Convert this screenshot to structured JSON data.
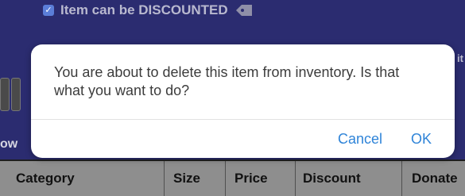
{
  "background": {
    "discount_option": {
      "checked": true,
      "check_glyph": "✓",
      "label": "Item can be DISCOUNTED"
    },
    "right_edge_text": "it",
    "left_edge_text": "ow"
  },
  "table": {
    "headers": [
      "Category",
      "Size",
      "Price",
      "Discount",
      "Donate"
    ]
  },
  "dialog": {
    "message": "You are about to delete this item from inventory. Is that what you want to do?",
    "cancel_label": "Cancel",
    "ok_label": "OK"
  },
  "colors": {
    "app_background": "#2b2c70",
    "dialog_button": "#2f84d8",
    "table_header": "#8e8e8e"
  }
}
